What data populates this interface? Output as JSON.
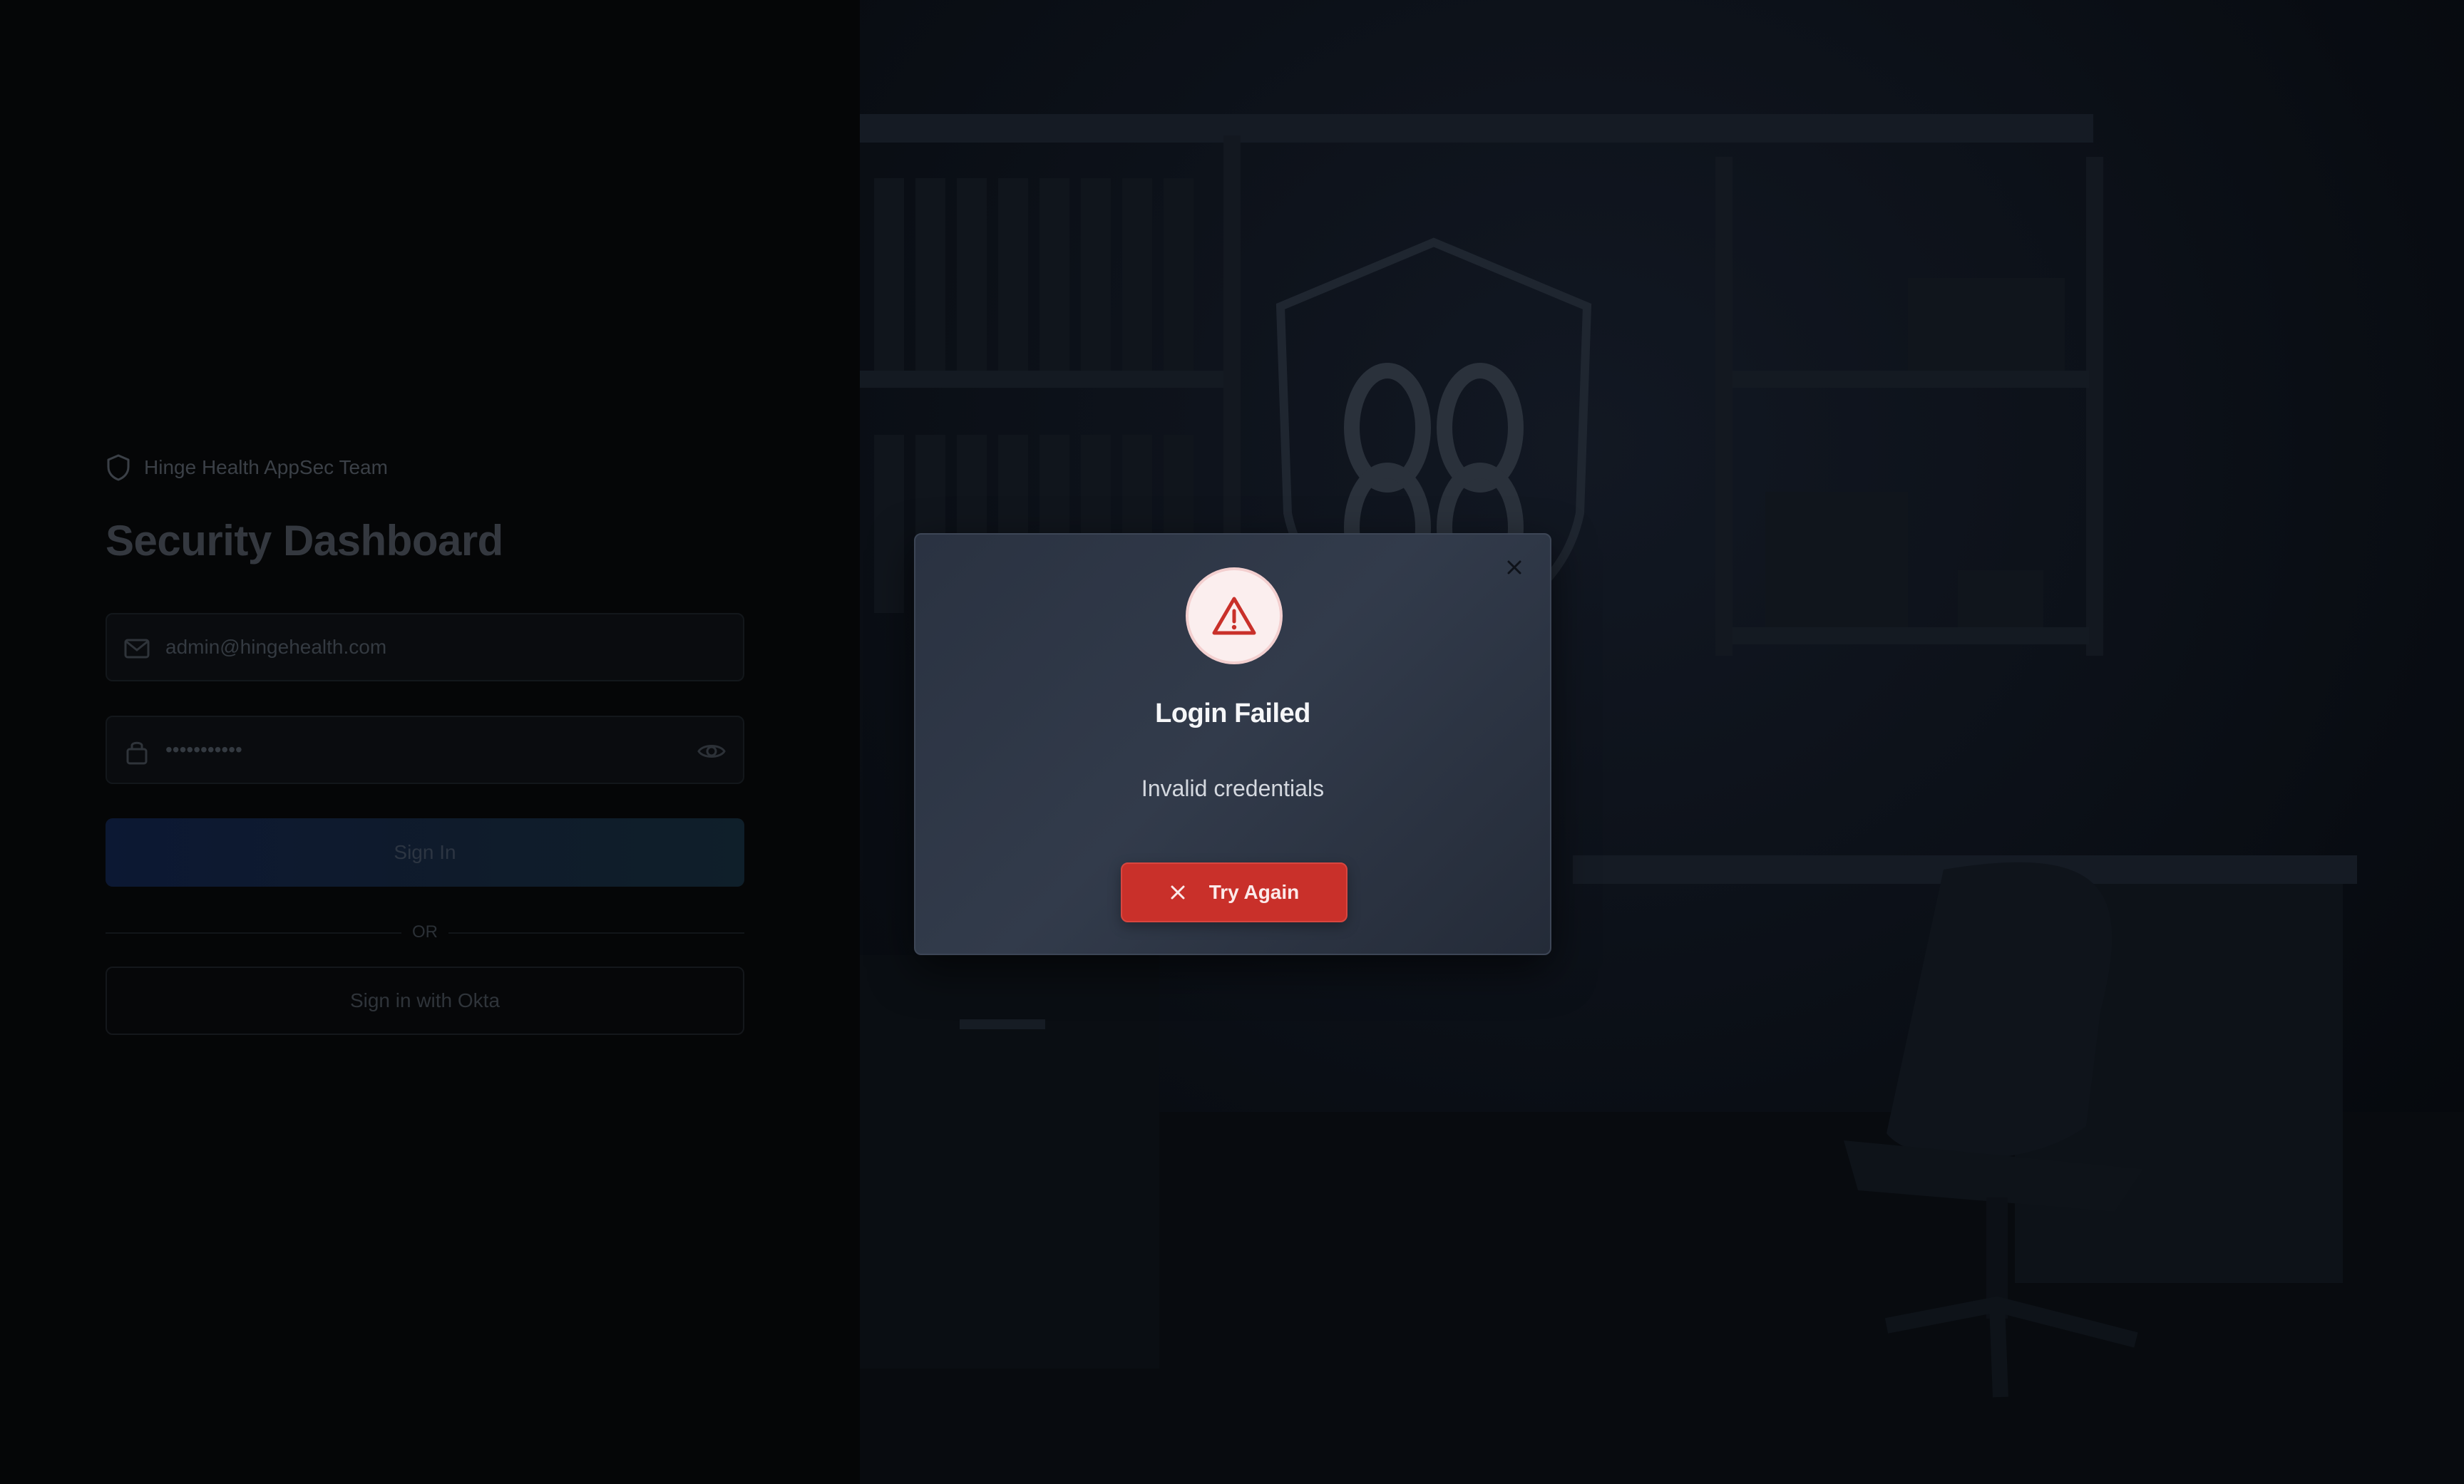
{
  "brand": {
    "team_name": "Hinge Health AppSec Team"
  },
  "login": {
    "title": "Security Dashboard",
    "email_value": "admin@hingehealth.com",
    "password_value": "•••••••••••",
    "sign_in_label": "Sign In",
    "divider_label": "OR",
    "okta_label": "Sign in with Okta"
  },
  "modal": {
    "title": "Login Failed",
    "message": "Invalid credentials",
    "button_label": "Try Again",
    "icon": "warning-triangle-icon",
    "accent_color": "#c9302a"
  }
}
